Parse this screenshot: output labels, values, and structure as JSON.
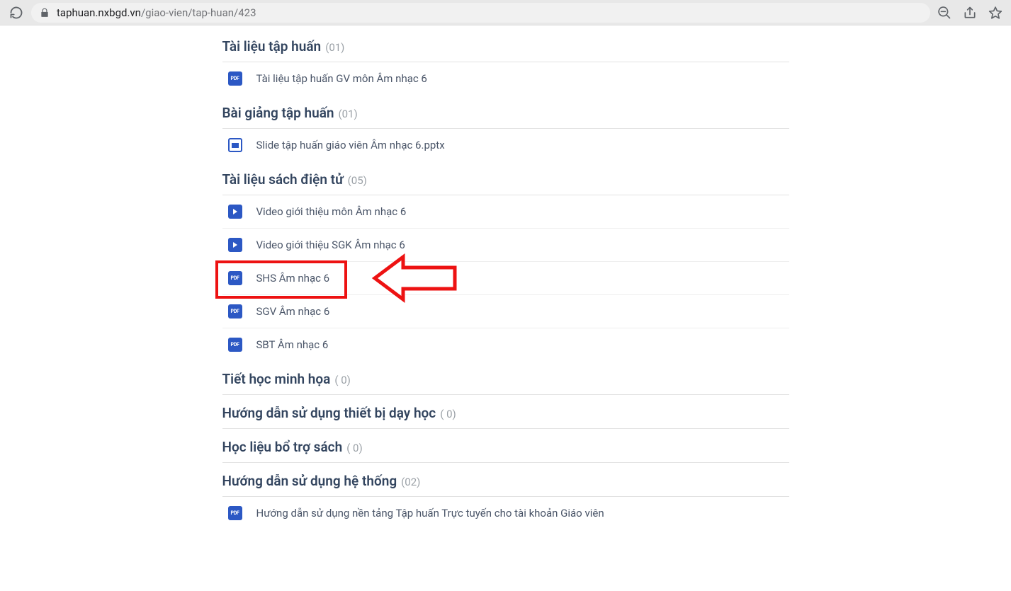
{
  "browser": {
    "url_domain": "taphuan.nxbgd.vn",
    "url_path": "/giao-vien/tap-huan/423"
  },
  "sections": [
    {
      "title": "Tài liệu tập huấn",
      "count": "(01)",
      "items": [
        {
          "icon": "pdf",
          "label": "Tài liệu tập huấn GV môn Âm nhạc 6"
        }
      ]
    },
    {
      "title": "Bài giảng tập huấn",
      "count": "(01)",
      "items": [
        {
          "icon": "slide",
          "label": "Slide tập huấn giáo viên Âm nhạc 6.pptx"
        }
      ]
    },
    {
      "title": "Tài liệu sách điện tử",
      "count": "(05)",
      "items": [
        {
          "icon": "video",
          "label": "Video giới thiệu môn Âm nhạc 6"
        },
        {
          "icon": "video",
          "label": "Video giới thiệu SGK Âm nhạc 6"
        },
        {
          "icon": "pdf",
          "label": "SHS Âm nhạc 6",
          "highlight": true
        },
        {
          "icon": "pdf",
          "label": "SGV Âm nhạc 6"
        },
        {
          "icon": "pdf",
          "label": "SBT Âm nhạc 6"
        }
      ]
    },
    {
      "title": "Tiết học minh họa",
      "count": "( 0)",
      "items": []
    },
    {
      "title": "Hướng dẫn sử dụng thiết bị dạy học",
      "count": "( 0)",
      "items": []
    },
    {
      "title": "Học liệu bổ trợ sách",
      "count": "( 0)",
      "items": []
    },
    {
      "title": "Hướng dẫn sử dụng hệ thống",
      "count": "(02)",
      "items": [
        {
          "icon": "pdf",
          "label": "Hướng dẫn sử dụng nền tảng Tập huấn Trực tuyến cho tài khoản Giáo viên"
        }
      ]
    }
  ],
  "pdf_label": "PDF"
}
